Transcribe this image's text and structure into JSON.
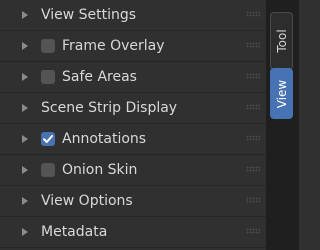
{
  "panels": [
    {
      "label": "View Settings",
      "checkbox": false
    },
    {
      "label": "Frame Overlay",
      "checkbox": true,
      "checked": false
    },
    {
      "label": "Safe Areas",
      "checkbox": true,
      "checked": false
    },
    {
      "label": "Scene Strip Display",
      "checkbox": false
    },
    {
      "label": "Annotations",
      "checkbox": true,
      "checked": true
    },
    {
      "label": "Onion Skin",
      "checkbox": true,
      "checked": false
    },
    {
      "label": "View Options",
      "checkbox": false
    },
    {
      "label": "Metadata",
      "checkbox": false
    }
  ],
  "tabs": {
    "tool": "Tool",
    "view": "View"
  },
  "colors": {
    "accent": "#4772b3",
    "background": "#303030",
    "tabbar": "#1f1f1f"
  }
}
